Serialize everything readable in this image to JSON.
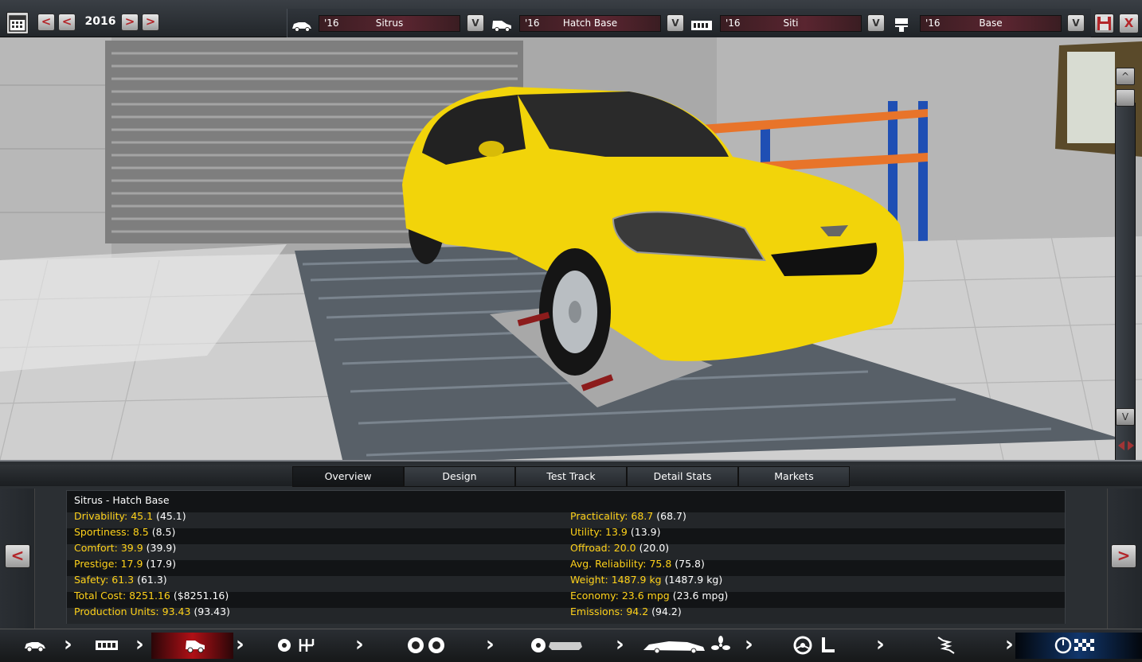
{
  "header": {
    "year": "2016",
    "selectors": [
      {
        "year": "'16",
        "name": "Sitrus",
        "icon": "company-car-icon"
      },
      {
        "year": "'16",
        "name": "Hatch Base",
        "icon": "model-car-icon"
      },
      {
        "year": "'16",
        "name": "Siti",
        "icon": "engine-block-icon"
      },
      {
        "year": "'16",
        "name": "Base",
        "icon": "piston-icon"
      }
    ],
    "dropdown_glyph": "V",
    "prev_glyph": "<",
    "next_glyph": ">",
    "close_glyph": "X"
  },
  "tabs": [
    {
      "label": "Overview",
      "active": true
    },
    {
      "label": "Design",
      "active": false
    },
    {
      "label": "Test Track",
      "active": false
    },
    {
      "label": "Detail Stats",
      "active": false
    },
    {
      "label": "Markets",
      "active": false
    }
  ],
  "stats": {
    "title": "Sitrus - Hatch Base",
    "left": [
      {
        "label": "Drivability: 45.1",
        "paren": "(45.1)"
      },
      {
        "label": "Sportiness: 8.5",
        "paren": "(8.5)"
      },
      {
        "label": "Comfort: 39.9",
        "paren": "(39.9)"
      },
      {
        "label": "Prestige: 17.9",
        "paren": "(17.9)"
      },
      {
        "label": "Safety: 61.3",
        "paren": "(61.3)"
      },
      {
        "label": "Total Cost: 8251.16",
        "paren": "($8251.16)"
      },
      {
        "label": "Production Units: 93.43",
        "paren": "(93.43)"
      }
    ],
    "right": [
      {
        "label": "Practicality: 68.7",
        "paren": "(68.7)"
      },
      {
        "label": "Utility: 13.9",
        "paren": "(13.9)"
      },
      {
        "label": "Offroad: 20.0",
        "paren": "(20.0)"
      },
      {
        "label": "Avg. Reliability: 75.8",
        "paren": "(75.8)"
      },
      {
        "label": "Weight: 1487.9 kg",
        "paren": "(1487.9 kg)"
      },
      {
        "label": "Economy: 23.6 mpg",
        "paren": "(23.6 mpg)"
      },
      {
        "label": "Emissions: 94.2",
        "paren": "(94.2)"
      }
    ]
  },
  "scene": {
    "car_color": "#f2d40a",
    "scroll_up_glyph": "^",
    "scroll_down_glyph": "V"
  },
  "nav": {
    "icons": [
      "car-icon",
      "chassis-icon",
      "body-icon",
      "engine-gears-icon",
      "wheels-icon",
      "interior-icon",
      "aerodynamics-icon",
      "steering-seat-icon",
      "suspension-icon",
      "test-track-icon"
    ],
    "active_color": "#b01016",
    "highlight_color": "#11366b"
  }
}
